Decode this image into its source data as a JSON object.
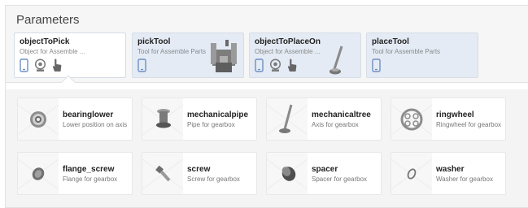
{
  "header": {
    "title": "Parameters"
  },
  "parameters": [
    {
      "name": "objectToPick",
      "description": "Object for Assemble ...",
      "icons": [
        "tablet-icon",
        "webcam-icon",
        "hand-pointer-icon"
      ]
    },
    {
      "name": "pickTool",
      "description": "Tool for Assemble Parts",
      "icons": [
        "tablet-icon"
      ]
    },
    {
      "name": "objectToPlaceOn",
      "description": "Object for Assemble ...",
      "icons": [
        "tablet-icon",
        "webcam-icon",
        "hand-pointer-icon"
      ]
    },
    {
      "name": "placeTool",
      "description": "Tool for Assemble Parts",
      "icons": [
        "tablet-icon"
      ]
    }
  ],
  "parts": [
    {
      "name": "bearinglower",
      "description": "Lower position on axis"
    },
    {
      "name": "mechanicalpipe",
      "description": "Pipe for gearbox"
    },
    {
      "name": "mechanicaltree",
      "description": "Axis for gearbox"
    },
    {
      "name": "ringwheel",
      "description": "Ringwheel for gearbox"
    },
    {
      "name": "flange_screw",
      "description": "Flange for gearbox"
    },
    {
      "name": "screw",
      "description": "Screw for gearbox"
    },
    {
      "name": "spacer",
      "description": "Spacer for gearbox"
    },
    {
      "name": "washer",
      "description": "Washer for gearbox"
    }
  ],
  "colors": {
    "accent_tint": "#e4ebf5",
    "icon_blue": "#6f8fc0",
    "icon_dark": "#555555"
  }
}
